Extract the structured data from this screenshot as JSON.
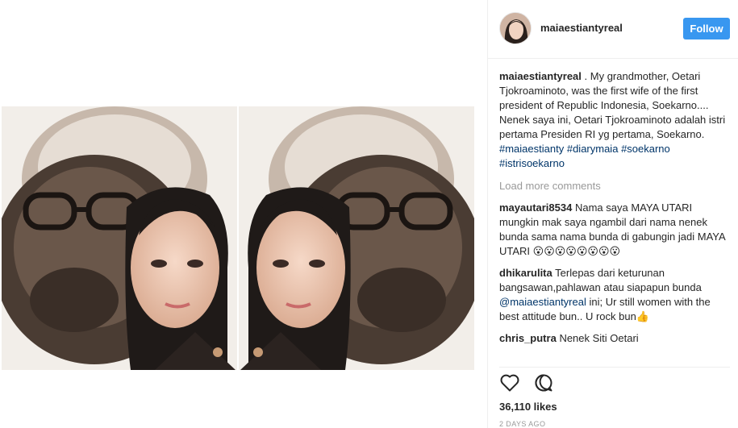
{
  "post": {
    "author": "maiaestiantyreal",
    "follow_label": "Follow",
    "caption": {
      "user": "maiaestiantyreal",
      "text": ". My grandmother, Oetari Tjokroaminoto, was the first wife of the first president of Republic Indonesia, Soekarno.... Nenek saya ini, Oetari Tjokroaminoto adalah istri pertama Presiden RI yg pertama, Soekarno.",
      "hashtags": [
        "#maiaestianty",
        "#diarymaia",
        "#soekarno",
        "#istrisoekarno"
      ]
    },
    "load_more": "Load more comments",
    "comments": [
      {
        "user": "mayautari8534",
        "text": "Nama saya MAYA UTARI mungkin mak saya ngambil dari nama nenek bunda sama nama bunda di gabungin jadi MAYA UTARI 😮😮😮😮😮😮😮😮"
      },
      {
        "user": "dhikarulita",
        "text_before": "Terlepas dari keturunan bangsawan,pahlawan atau siapapun bunda",
        "mention": "@maiaestiantyreal",
        "text_after": "ini; Ur still women with the best attitude bun.. U rock bun👍"
      },
      {
        "user": "chris_putra",
        "text": "Nenek Siti Oetari"
      }
    ],
    "likes": "36,110 likes",
    "timestamp": "2 DAYS AGO"
  },
  "icons": {
    "like": "heart-icon",
    "comment": "comment-bubble-icon"
  }
}
